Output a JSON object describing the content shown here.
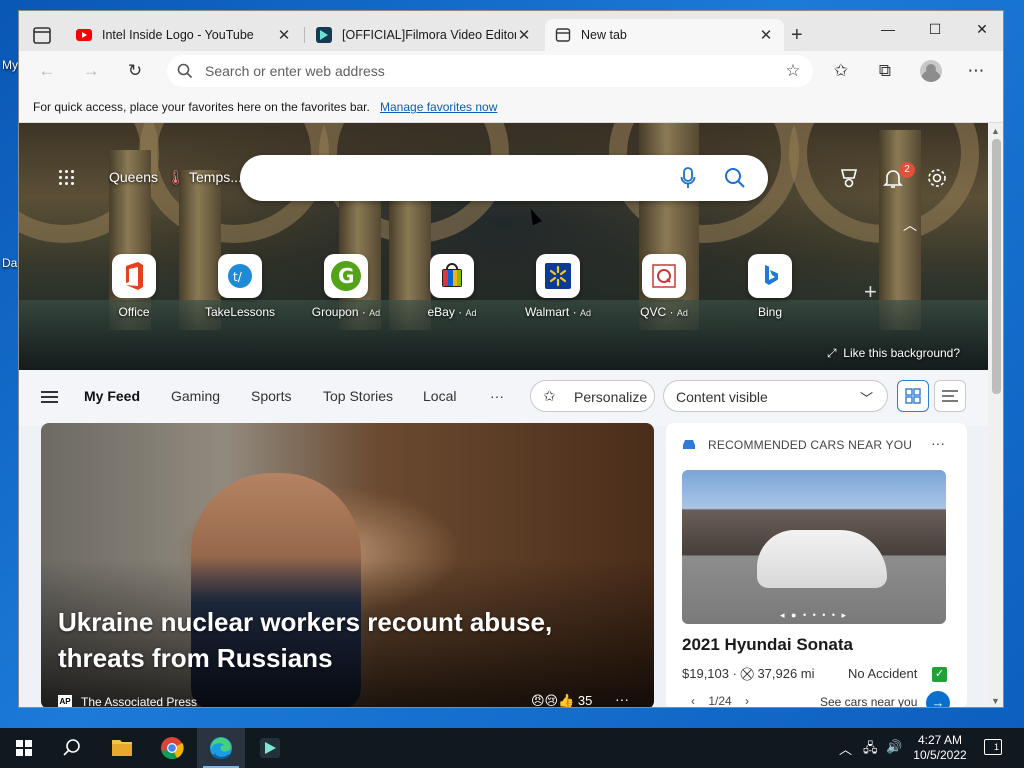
{
  "desktop": {
    "labels": [
      "My",
      "Da"
    ]
  },
  "browser": {
    "tabs": [
      {
        "title": "Intel Inside Logo - YouTube",
        "icon": "youtube-icon",
        "active": false
      },
      {
        "title": "[OFFICIAL]Filmora Video Editor (",
        "icon": "filmora-icon",
        "active": false
      },
      {
        "title": "New tab",
        "icon": "newtab-icon",
        "active": true
      }
    ],
    "address_placeholder": "Search or enter web address",
    "favbar_message": "For quick access, place your favorites here on the favorites bar.",
    "favbar_link": "Manage favorites now"
  },
  "newtab": {
    "location": "Queens",
    "weather": "Temps...",
    "notifications_count": "2",
    "quick_links": [
      {
        "label": "Office",
        "ad": ""
      },
      {
        "label": "TakeLessons",
        "ad": ""
      },
      {
        "label": "Groupon",
        "ad": "Ad"
      },
      {
        "label": "eBay",
        "ad": "Ad"
      },
      {
        "label": "Walmart",
        "ad": "Ad"
      },
      {
        "label": "QVC",
        "ad": "Ad"
      },
      {
        "label": "Bing",
        "ad": ""
      }
    ],
    "like_background": "Like this background?",
    "feed_tabs": [
      "My Feed",
      "Gaming",
      "Sports",
      "Top Stories",
      "Local"
    ],
    "more": "···",
    "personalize": "Personalize",
    "content_visibility": "Content visible",
    "headline": "Ukraine nuclear workers recount abuse, threats from Russians",
    "source_logo": "AP",
    "source": "The Associated Press",
    "reaction_count": "35",
    "cars": {
      "header": "RECOMMENDED CARS NEAR YOU",
      "name": "2021 Hyundai Sonata",
      "price": "$19,103",
      "mileage": "37,926 mi",
      "status": "No Accident",
      "pager": "1/24",
      "cta": "See cars near you"
    }
  },
  "taskbar": {
    "time": "4:27 AM",
    "date": "10/5/2022",
    "notification_count": "1"
  }
}
